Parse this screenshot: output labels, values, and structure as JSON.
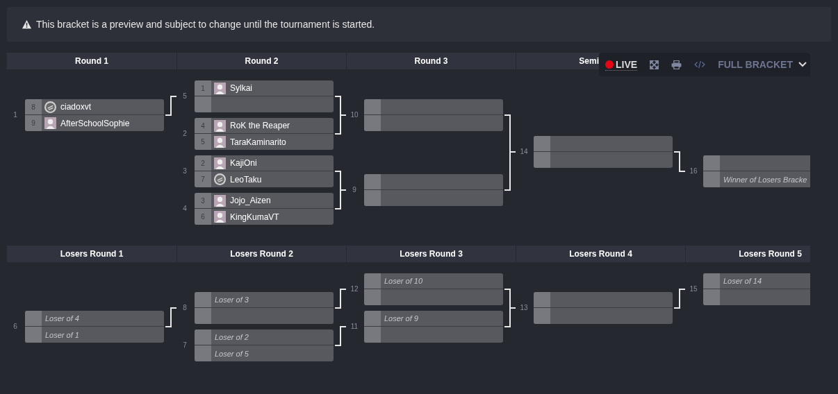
{
  "notice": {
    "text": "This bracket is a preview and subject to change until the tournament is started."
  },
  "toolbar": {
    "live_label": "LIVE",
    "view_label": "FULL BRACKET"
  },
  "winners": {
    "rounds": [
      {
        "title": "Round 1",
        "matches": [
          {
            "number": "1",
            "slots": [
              {
                "kind": "player",
                "seed": "8",
                "name": "ciadoxvt",
                "avatar": {
                  "kind": "default"
                }
              },
              {
                "kind": "player",
                "seed": "9",
                "name": "AfterSchoolSophie"
              }
            ]
          }
        ]
      },
      {
        "title": "Round 2",
        "matches": [
          {
            "number": "5",
            "slots": [
              {
                "kind": "player",
                "seed": "1",
                "name": "Sylkai"
              },
              {
                "kind": "empty"
              }
            ]
          },
          {
            "number": "2",
            "slots": [
              {
                "kind": "player",
                "seed": "4",
                "name": "RoK the Reaper"
              },
              {
                "kind": "player",
                "seed": "5",
                "name": "TaraKaminarito"
              }
            ]
          },
          {
            "number": "3",
            "slots": [
              {
                "kind": "player",
                "seed": "2",
                "name": "KajiOni"
              },
              {
                "kind": "player",
                "seed": "7",
                "name": "LeoTaku",
                "avatar": {
                  "kind": "default"
                }
              }
            ]
          },
          {
            "number": "4",
            "slots": [
              {
                "kind": "player",
                "seed": "3",
                "name": "Jojo_Aizen"
              },
              {
                "kind": "player",
                "seed": "6",
                "name": "KingKumaVT"
              }
            ]
          }
        ]
      },
      {
        "title": "Round 3",
        "matches": [
          {
            "number": "10",
            "slots": [
              {
                "kind": "empty"
              },
              {
                "kind": "empty"
              }
            ]
          },
          {
            "number": "9",
            "slots": [
              {
                "kind": "empty"
              },
              {
                "kind": "empty"
              }
            ]
          }
        ]
      },
      {
        "title": "Semi",
        "matches": [
          {
            "number": "14",
            "slots": [
              {
                "kind": "empty"
              },
              {
                "kind": "empty"
              }
            ]
          }
        ]
      },
      {
        "matches": [
          {
            "number": "16",
            "slots": [
              {
                "kind": "empty"
              },
              {
                "kind": "placeholder",
                "text": "Winner of Losers Bracke"
              }
            ]
          }
        ]
      }
    ]
  },
  "losers": {
    "rounds": [
      {
        "title": "Losers Round 1",
        "matches": [
          {
            "number": "6",
            "slots": [
              {
                "kind": "placeholder",
                "text": "Loser of 4"
              },
              {
                "kind": "placeholder",
                "text": "Loser of 1"
              }
            ]
          }
        ]
      },
      {
        "title": "Losers Round 2",
        "matches": [
          {
            "number": "8",
            "slots": [
              {
                "kind": "placeholder",
                "text": "Loser of 3"
              },
              {
                "kind": "empty"
              }
            ]
          },
          {
            "number": "7",
            "slots": [
              {
                "kind": "placeholder",
                "text": "Loser of 2"
              },
              {
                "kind": "placeholder",
                "text": "Loser of 5"
              }
            ]
          }
        ]
      },
      {
        "title": "Losers Round 3",
        "matches": [
          {
            "number": "12",
            "slots": [
              {
                "kind": "placeholder",
                "text": "Loser of 10"
              },
              {
                "kind": "empty"
              }
            ]
          },
          {
            "number": "11",
            "slots": [
              {
                "kind": "placeholder",
                "text": "Loser of 9"
              },
              {
                "kind": "empty"
              }
            ]
          }
        ]
      },
      {
        "title": "Losers Round 4",
        "matches": [
          {
            "number": "13",
            "slots": [
              {
                "kind": "empty"
              },
              {
                "kind": "empty"
              }
            ]
          }
        ]
      },
      {
        "title": "Losers Round 5",
        "matches": [
          {
            "number": "15",
            "slots": [
              {
                "kind": "placeholder",
                "text": "Loser of 14"
              },
              {
                "kind": "empty"
              }
            ]
          }
        ]
      }
    ]
  }
}
